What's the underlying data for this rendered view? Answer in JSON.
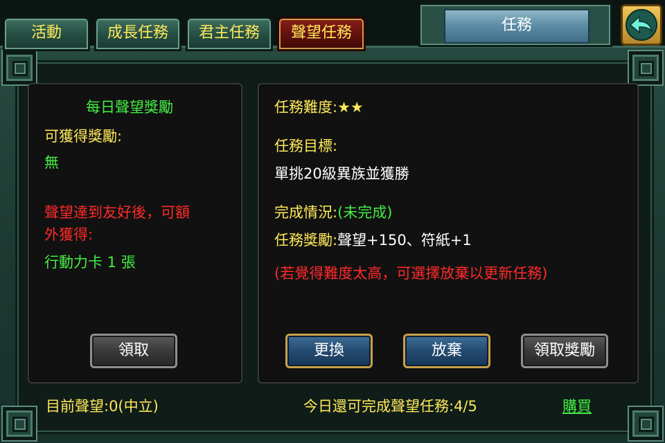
{
  "tabs": [
    {
      "label": "活動",
      "active": false
    },
    {
      "label": "成長任務",
      "active": false
    },
    {
      "label": "君主任務",
      "active": false
    },
    {
      "label": "聲望任務",
      "active": true
    }
  ],
  "title": "任務",
  "back_icon": "back-arrow-icon",
  "left": {
    "heading": "每日聲望獎勵",
    "reward_label": "可獲得獎勵:",
    "reward_value": "無",
    "extra_line1": "聲望達到友好後，可額",
    "extra_line2": "外獲得:",
    "extra_value": "行動力卡 1 張",
    "claim_button": "領取"
  },
  "right": {
    "difficulty_label": "任務難度:",
    "difficulty_stars": "★★",
    "goal_label": "任務目標:",
    "goal_value": "單挑20級異族並獲勝",
    "status_label": "完成情況:",
    "status_value": "(未完成)",
    "reward_label": "任務獎勵:",
    "reward_value": "聲望+150、符紙+1",
    "hint": "(若覺得難度太高，可選擇放棄以更新任務)",
    "change_button": "更換",
    "abandon_button": "放棄",
    "claim_reward_button": "領取獎勵"
  },
  "footer": {
    "current_reputation": "目前聲望:0(中立)",
    "remaining": "今日還可完成聲望任務:4/5",
    "buy": "購買"
  },
  "colors": {
    "yellow": "#ffe95a",
    "green": "#44ee44",
    "red": "#ff2a2a"
  }
}
